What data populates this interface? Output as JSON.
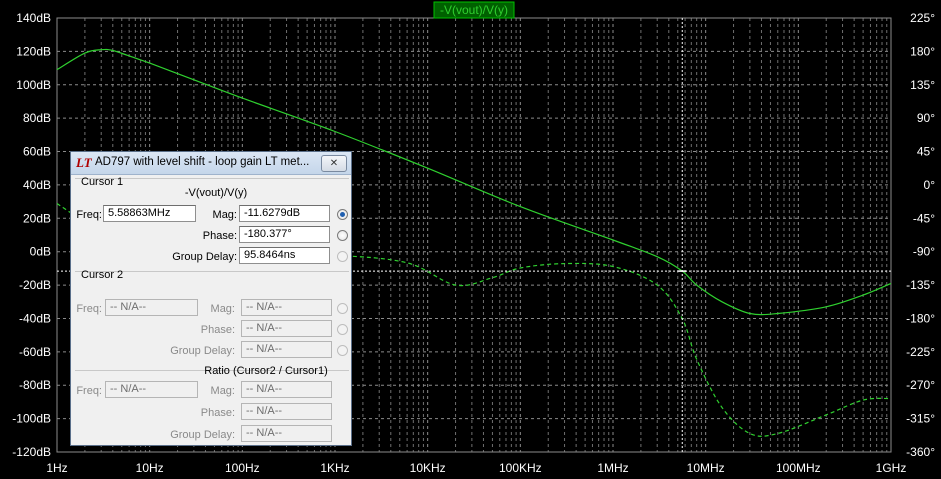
{
  "plot": {
    "title": "-V(vout)/V(y)",
    "colors": {
      "background": "#000000",
      "grid": "#8c8c8c",
      "trace": "#2fd02f",
      "title_bg": "#006000",
      "title_border": "#00c000",
      "text": "#ffffff"
    }
  },
  "chart_data": {
    "type": "line",
    "title": "-V(vout)/V(y)",
    "x_scale": "log",
    "xlim": [
      1,
      1000000000
    ],
    "x_ticks": [
      {
        "value": 1,
        "label": "1Hz"
      },
      {
        "value": 10,
        "label": "10Hz"
      },
      {
        "value": 100,
        "label": "100Hz"
      },
      {
        "value": 1000,
        "label": "1KHz"
      },
      {
        "value": 10000,
        "label": "10KHz"
      },
      {
        "value": 100000,
        "label": "100KHz"
      },
      {
        "value": 1000000,
        "label": "1MHz"
      },
      {
        "value": 10000000,
        "label": "10MHz"
      },
      {
        "value": 100000000,
        "label": "100MHz"
      },
      {
        "value": 1000000000,
        "label": "1GHz"
      }
    ],
    "ylim_left": [
      -120,
      140
    ],
    "y_ticks_left": [
      {
        "value": 140,
        "label": "140dB"
      },
      {
        "value": 120,
        "label": "120dB"
      },
      {
        "value": 100,
        "label": "100dB"
      },
      {
        "value": 80,
        "label": "80dB"
      },
      {
        "value": 60,
        "label": "60dB"
      },
      {
        "value": 40,
        "label": "40dB"
      },
      {
        "value": 20,
        "label": "20dB"
      },
      {
        "value": 0,
        "label": "0dB"
      },
      {
        "value": -20,
        "label": "-20dB"
      },
      {
        "value": -40,
        "label": "-40dB"
      },
      {
        "value": -60,
        "label": "-60dB"
      },
      {
        "value": -80,
        "label": "-80dB"
      },
      {
        "value": -100,
        "label": "-100dB"
      },
      {
        "value": -120,
        "label": "-120dB"
      }
    ],
    "ylim_right": [
      -360,
      225
    ],
    "y_ticks_right": [
      {
        "value": 225,
        "label": "225°"
      },
      {
        "value": 180,
        "label": "180°"
      },
      {
        "value": 135,
        "label": "135°"
      },
      {
        "value": 90,
        "label": "90°"
      },
      {
        "value": 45,
        "label": "45°"
      },
      {
        "value": 0,
        "label": "0°"
      },
      {
        "value": -45,
        "label": "-45°"
      },
      {
        "value": -90,
        "label": "-90°"
      },
      {
        "value": -135,
        "label": "-135°"
      },
      {
        "value": -180,
        "label": "-180°"
      },
      {
        "value": -225,
        "label": "-225°"
      },
      {
        "value": -270,
        "label": "-270°"
      },
      {
        "value": -315,
        "label": "-315°"
      },
      {
        "value": -360,
        "label": "-360°"
      }
    ],
    "series": [
      {
        "name": "magnitude",
        "axis": "left",
        "style": "solid",
        "points": [
          [
            1,
            109
          ],
          [
            2,
            119
          ],
          [
            3,
            121
          ],
          [
            4,
            120.5
          ],
          [
            7,
            116
          ],
          [
            10,
            113
          ],
          [
            30,
            103
          ],
          [
            100,
            92
          ],
          [
            1000,
            72
          ],
          [
            10000,
            50
          ],
          [
            100000,
            27
          ],
          [
            1000000,
            7
          ],
          [
            3000000,
            -3
          ],
          [
            5588630,
            -11.6
          ],
          [
            8000000,
            -20
          ],
          [
            15000000,
            -30
          ],
          [
            30000000,
            -37
          ],
          [
            60000000,
            -37
          ],
          [
            200000000,
            -33
          ],
          [
            500000000,
            -26
          ],
          [
            1000000000,
            -19
          ]
        ]
      },
      {
        "name": "phase",
        "axis": "right",
        "style": "dashed",
        "points": [
          [
            1,
            -25
          ],
          [
            2,
            -50
          ],
          [
            4,
            -72
          ],
          [
            10,
            -88
          ],
          [
            30,
            -93
          ],
          [
            100,
            -94
          ],
          [
            1000,
            -95
          ],
          [
            6000,
            -105
          ],
          [
            20000,
            -135
          ],
          [
            50000,
            -125
          ],
          [
            100000,
            -112
          ],
          [
            300000,
            -106
          ],
          [
            1000000,
            -110
          ],
          [
            3000000,
            -135
          ],
          [
            5588630,
            -180.4
          ],
          [
            8000000,
            -235
          ],
          [
            15000000,
            -300
          ],
          [
            30000000,
            -335
          ],
          [
            60000000,
            -335
          ],
          [
            200000000,
            -310
          ],
          [
            500000000,
            -290
          ],
          [
            1000000000,
            -288
          ]
        ]
      }
    ],
    "cursor": {
      "x": 5588630,
      "y_left": -11.6279
    }
  },
  "dialog": {
    "title": "AD797 with level shift - loop gain LT met...",
    "logo": "LT",
    "close": "✕",
    "cursor1": {
      "section": "Cursor 1",
      "expression": "-V(vout)/V(y)",
      "freq_label": "Freq:",
      "freq": "5.58863MHz",
      "mag_label": "Mag:",
      "mag": "-11.6279dB",
      "phase_label": "Phase:",
      "phase": "-180.377°",
      "gd_label": "Group Delay:",
      "gd": "95.8464ns"
    },
    "cursor2": {
      "section": "Cursor 2",
      "freq_label": "Freq:",
      "freq": "-- N/A--",
      "mag_label": "Mag:",
      "mag": "-- N/A--",
      "phase_label": "Phase:",
      "phase": "-- N/A--",
      "gd_label": "Group Delay:",
      "gd": "-- N/A--"
    },
    "ratio": {
      "section": "Ratio (Cursor2 / Cursor1)",
      "freq_label": "Freq:",
      "freq": "-- N/A--",
      "mag_label": "Mag:",
      "mag": "-- N/A--",
      "phase_label": "Phase:",
      "phase": "-- N/A--",
      "gd_label": "Group Delay:",
      "gd": "-- N/A--"
    }
  }
}
